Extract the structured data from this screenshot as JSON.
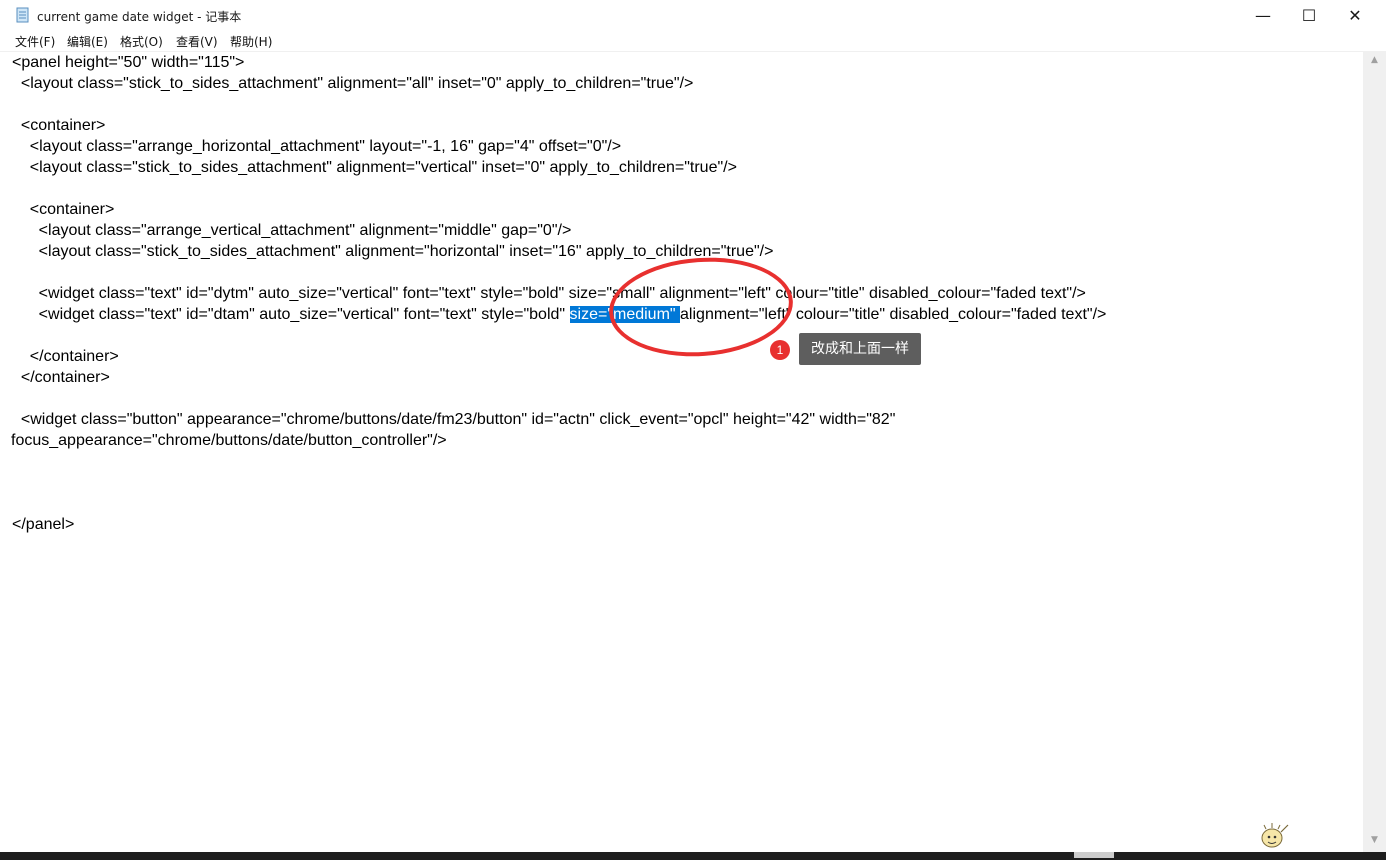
{
  "window": {
    "title": "current game date widget - 记事本",
    "controls": {
      "minimize": "—",
      "maximize": "☐",
      "close": "✕"
    }
  },
  "menu": {
    "items": [
      "文件(F)",
      "编辑(E)",
      "格式(O)",
      "查看(V)",
      "帮助(H)"
    ]
  },
  "editor": {
    "lines": [
      "<panel height=\"50\" width=\"115\">",
      "  <layout class=\"stick_to_sides_attachment\" alignment=\"all\" inset=\"0\" apply_to_children=\"true\"/>",
      "",
      "  <container>",
      "    <layout class=\"arrange_horizontal_attachment\" layout=\"-1, 16\" gap=\"4\" offset=\"0\"/>",
      "    <layout class=\"stick_to_sides_attachment\" alignment=\"vertical\" inset=\"0\" apply_to_children=\"true\"/>",
      "",
      "    <container>",
      "      <layout class=\"arrange_vertical_attachment\" alignment=\"middle\" gap=\"0\"/>",
      "      <layout class=\"stick_to_sides_attachment\" alignment=\"horizontal\" inset=\"16\" apply_to_children=\"true\"/>",
      "",
      "      <widget class=\"text\" id=\"dytm\" auto_size=\"vertical\" font=\"text\" style=\"bold\" size=\"small\" alignment=\"left\" colour=\"title\" disabled_colour=\"faded text\"/>",
      "",
      "",
      "    </container>",
      "  </container>",
      "",
      "  <widget class=\"button\" appearance=\"chrome/buttons/date/fm23/button\" id=\"actn\" click_event=\"opcl\" height=\"42\" width=\"82\"",
      "focus_appearance=\"chrome/buttons/date/button_controller\"/>",
      "",
      "",
      "",
      "</panel>"
    ],
    "selected_line": {
      "before": "      <widget class=\"text\" id=\"dtam\" auto_size=\"vertical\" font=\"text\" style=\"bold\" ",
      "selected": "size=\"medium\" ",
      "after": "alignment=\"left\" colour=\"title\" disabled_colour=\"faded text\"/>"
    }
  },
  "annotation": {
    "number": "1",
    "note": "改成和上面一样",
    "color": "#e8302f"
  },
  "colors": {
    "selection": "#0078d7",
    "tooltip_bg": "#5e5e5e"
  }
}
